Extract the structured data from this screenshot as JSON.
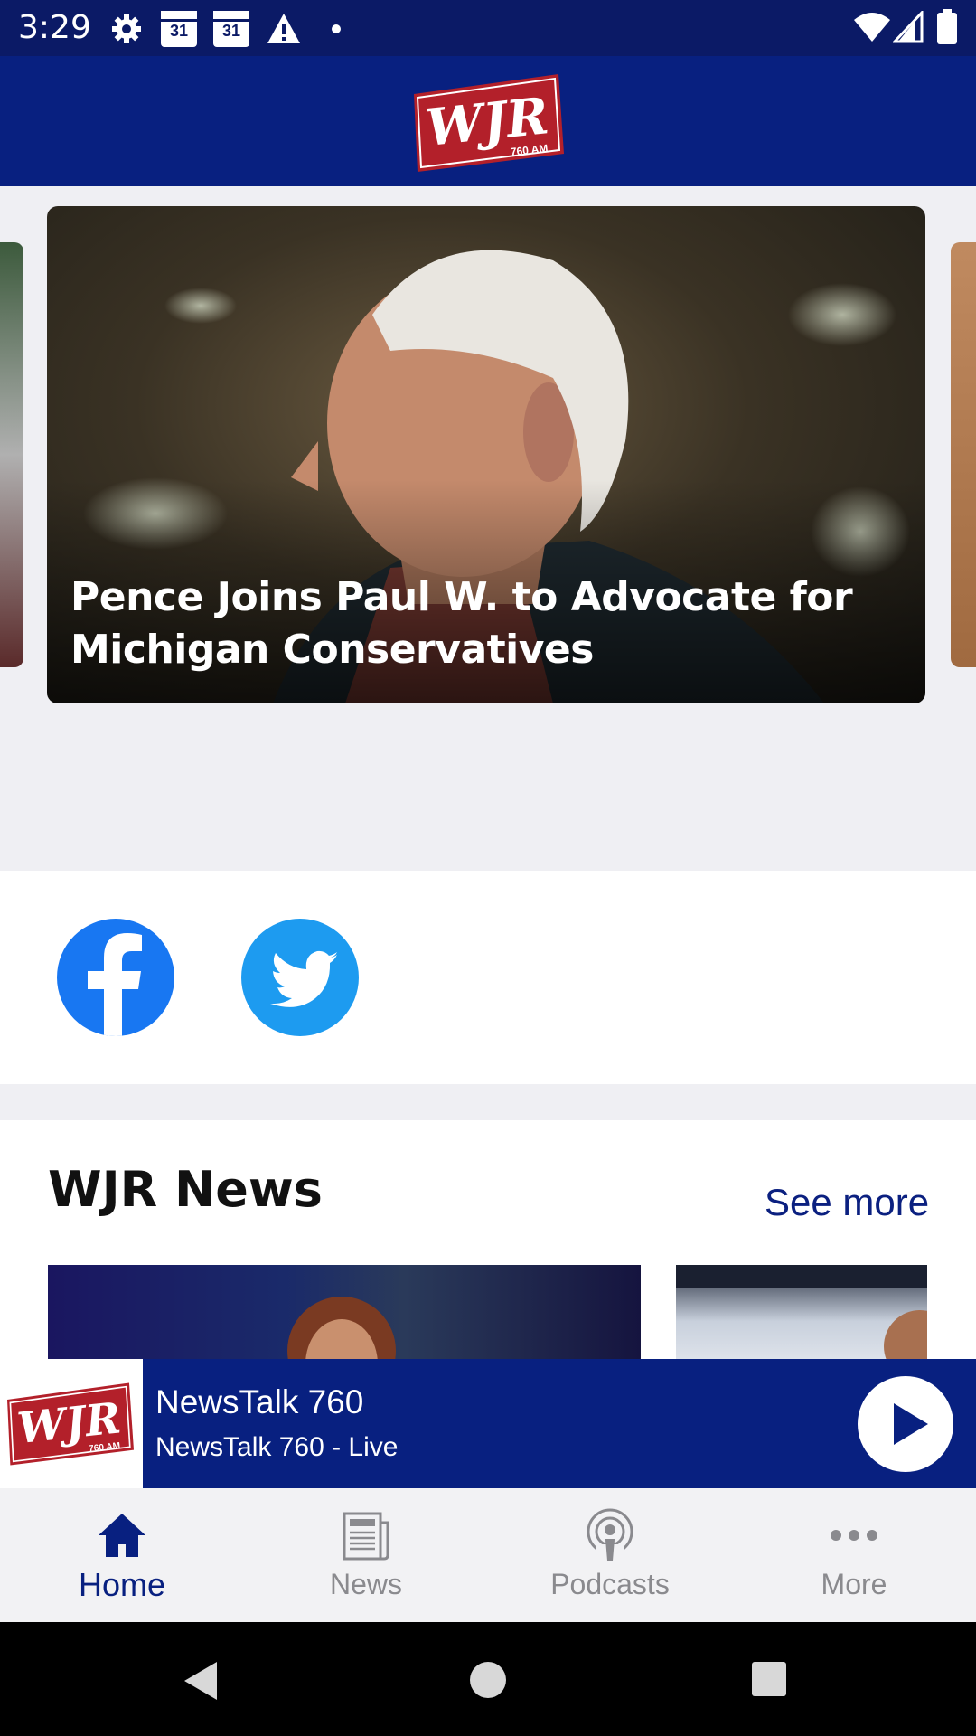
{
  "status_bar": {
    "time": "3:29",
    "calendar_day_1": "31",
    "calendar_day_2": "31"
  },
  "header": {
    "logo_text": "WJR",
    "logo_subtext": "760 AM",
    "brand_color": "#082080",
    "logo_color": "#b3202a"
  },
  "carousel": {
    "featured_title": "Pence Joins Paul W. to Advocate for Michigan Conservatives"
  },
  "social": {
    "facebook_color": "#1877f2",
    "twitter_color": "#1d9bf0"
  },
  "news": {
    "heading": "WJR News",
    "see_more": "See more"
  },
  "player": {
    "title": "NewsTalk 760",
    "subtitle": "NewsTalk 760 - Live"
  },
  "bottom_nav": {
    "items": [
      {
        "label": "Home",
        "icon": "home-icon",
        "active": true
      },
      {
        "label": "News",
        "icon": "newspaper-icon",
        "active": false
      },
      {
        "label": "Podcasts",
        "icon": "podcast-icon",
        "active": false
      },
      {
        "label": "More",
        "icon": "more-icon",
        "active": false
      }
    ]
  }
}
